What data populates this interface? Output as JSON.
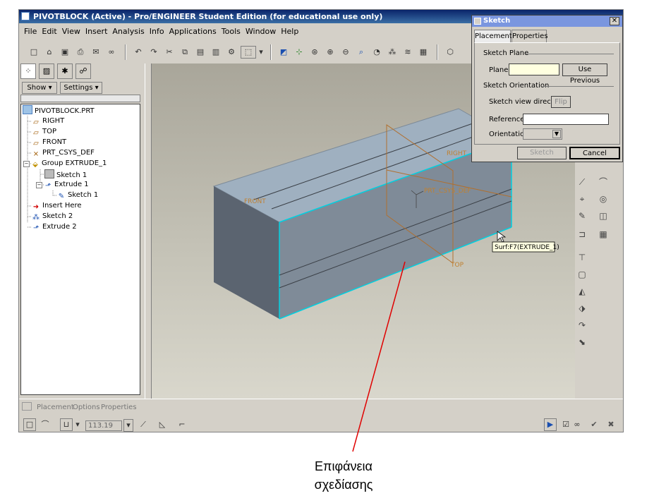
{
  "window": {
    "title": "PIVOTBLOCK (Active) - Pro/ENGINEER Student Edition (for educational use only)"
  },
  "menubar": [
    "File",
    "Edit",
    "View",
    "Insert",
    "Analysis",
    "Info",
    "Applications",
    "Tools",
    "Window",
    "Help"
  ],
  "toolbar": {
    "icons": [
      "new-icon",
      "open-icon",
      "save-icon",
      "print-icon",
      "email-icon",
      "link-icon",
      "undo-icon",
      "redo-icon",
      "cut-icon",
      "copy-icon",
      "paste-icon",
      "paste-special-icon",
      "regenerate-icon",
      "find-icon",
      "select-box-icon",
      "dropdown-icon",
      "repaint-icon",
      "spin-center-icon",
      "orient-icon",
      "zoom-in-icon",
      "zoom-out-icon",
      "refit-icon",
      "saved-views-icon",
      "datum-display-icon",
      "layers-icon",
      "shading-icon",
      "wireframe-icon"
    ]
  },
  "navigator": {
    "show_label": "Show",
    "settings_label": "Settings",
    "tree": [
      {
        "label": "PIVOTBLOCK.PRT",
        "icon": "part-icon",
        "level": 0
      },
      {
        "label": "RIGHT",
        "icon": "datum-plane-icon",
        "level": 1
      },
      {
        "label": "TOP",
        "icon": "datum-plane-icon",
        "level": 1
      },
      {
        "label": "FRONT",
        "icon": "datum-plane-icon",
        "level": 1
      },
      {
        "label": "PRT_CSYS_DEF",
        "icon": "csys-icon",
        "level": 1
      },
      {
        "label": "Group EXTRUDE_1",
        "icon": "group-icon",
        "level": 1
      },
      {
        "label": "Sketch 1",
        "icon": "sketch-icon",
        "level": 2
      },
      {
        "label": "Extrude 1",
        "icon": "extrude-icon",
        "level": 2
      },
      {
        "label": "Sketch 1",
        "icon": "sketch-icon",
        "level": 3
      },
      {
        "label": "Insert Here",
        "icon": "insert-arrow-icon",
        "level": 1
      },
      {
        "label": "Sketch 2",
        "icon": "sketch-icon",
        "level": 1
      },
      {
        "label": "Extrude 2",
        "icon": "extrude-icon",
        "level": 1
      }
    ]
  },
  "graphics": {
    "datum_labels": {
      "right": "RIGHT",
      "front": "FRONT",
      "top": "TOP",
      "csys": "PRT_CSYS_DEF"
    },
    "tooltip": "Surf:F7(EXTRUDE_1)"
  },
  "dashboard": {
    "tabs": [
      "Placement",
      "Options",
      "Properties"
    ],
    "depth_value": "113.19"
  },
  "sketch_dialog": {
    "title": "Sketch",
    "tabs": [
      "Placement",
      "Properties"
    ],
    "sketch_plane_label": "Sketch Plane",
    "plane_label": "Plane",
    "use_previous_label": "Use Previous",
    "sketch_orientation_label": "Sketch Orientation",
    "view_direction_label": "Sketch view direction",
    "flip_label": "Flip",
    "reference_label": "Reference",
    "orientation_label": "Orientation",
    "sketch_button": "Sketch",
    "cancel_button": "Cancel"
  },
  "caption": {
    "line1": "Επιφάνεια",
    "line2": "σχεδίασης"
  },
  "colors": {
    "title_bar": "#0a246a",
    "accent_edge": "#00d0e0",
    "callout_line": "#e00000",
    "plane_field": "#ffffe0"
  }
}
